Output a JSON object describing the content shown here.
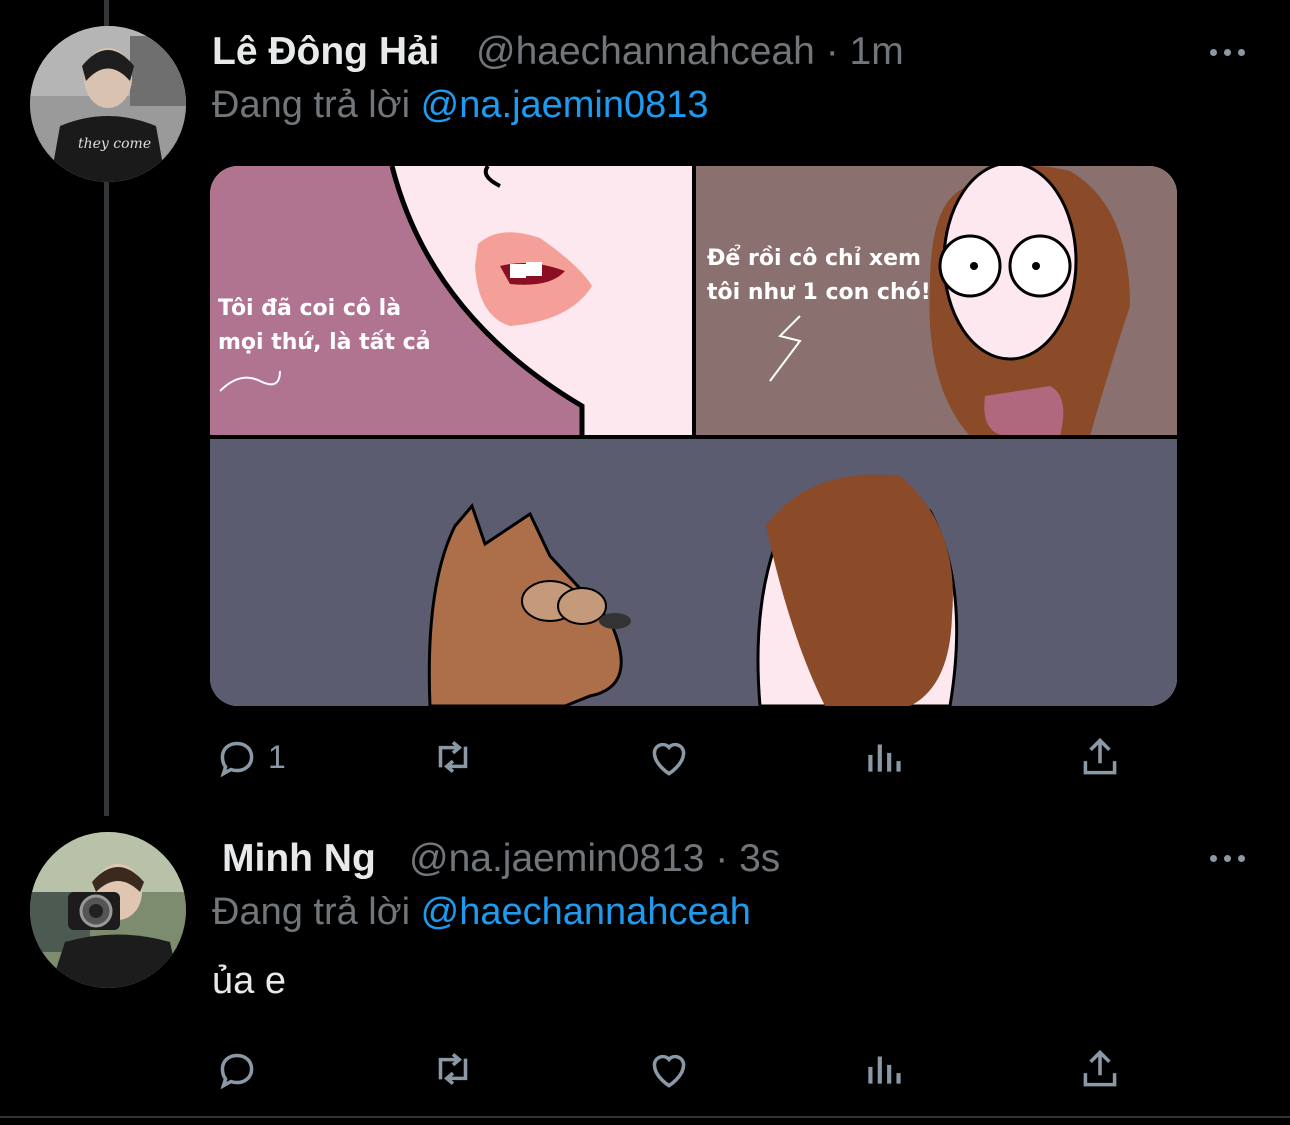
{
  "tweets": [
    {
      "display_name": "Lê Đông Hải",
      "handle": "@haechannahceah",
      "time": "· 1m",
      "replying_label": "Đang trả lời",
      "replying_to": "@na.jaemin0813",
      "avatar_caption": "they come",
      "comic": {
        "panel1_text": "Tôi đã coi cô là\nmọi thứ, là tất cả",
        "panel2_text": "Để rồi cô chỉ xem\ntôi như 1 con chó!"
      },
      "actions": {
        "reply_count": "1",
        "retweet_count": "",
        "like_count": ""
      }
    },
    {
      "display_name": "Minh Ng",
      "handle": "@na.jaemin0813",
      "time": "· 3s",
      "replying_label": "Đang trả lời",
      "replying_to": "@haechannahceah",
      "text": "ủa e",
      "actions": {
        "reply_count": "",
        "retweet_count": "",
        "like_count": ""
      }
    }
  ],
  "icons": [
    "more-icon",
    "reply-icon",
    "retweet-icon",
    "like-icon",
    "analytics-icon",
    "share-icon"
  ],
  "colors": {
    "background": "#000000",
    "accent": "#1d9bf0",
    "muted": "#71767b",
    "icon": "#8b98a5"
  }
}
